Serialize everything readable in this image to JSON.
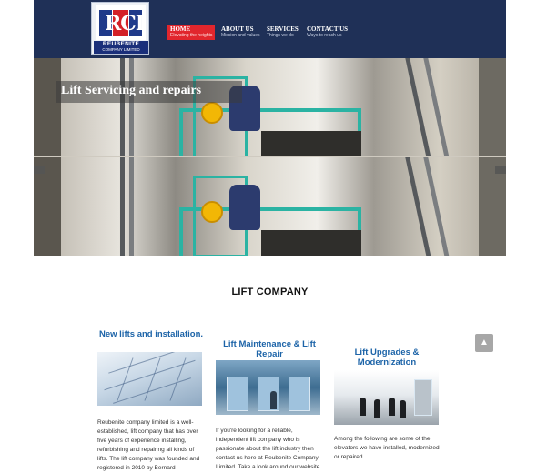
{
  "logo": {
    "letters": "RCI",
    "name": "REUBENITE",
    "subname": "COMPANY LIMITED"
  },
  "nav": [
    {
      "title": "HOME",
      "subtitle": "Elevating the heights",
      "active": true
    },
    {
      "title": "ABOUT US",
      "subtitle": "Mission and values",
      "active": false
    },
    {
      "title": "SERVICES",
      "subtitle": "Things we do",
      "active": false
    },
    {
      "title": "CONTACT US",
      "subtitle": "Ways to reach us",
      "active": false
    }
  ],
  "slider": {
    "caption": "Lift Servicing and repairs"
  },
  "section": {
    "title": "LIFT COMPANY"
  },
  "columns": [
    {
      "heading": "New lifts and installation.",
      "text": "Reubenite company limited is a well-established, lift company that has over five years of experience installing, refurbishing and repairing all kinds of lifts. The lift company was founded and registered in 2010 by Bernard"
    },
    {
      "heading": "Lift Maintenance & Lift Repair",
      "text": "If you're looking for a reliable, independent lift company who is passionate about the lift industry then contact us here at Reubenite Company Limited. Take a look around our website"
    },
    {
      "heading": "Lift Upgrades & Modernization",
      "text": "Among the following are some of the elevators we have installed, modernized or repaired."
    }
  ],
  "colors": {
    "header": "#1f3057",
    "nav_active": "#e1262d",
    "heading_blue": "#1d64a8",
    "accent_teal": "#2bb3a3"
  },
  "icons": {
    "back_to_top": "chevron-up-icon",
    "slider_prev": "chevron-left-icon",
    "slider_next": "chevron-right-icon"
  }
}
